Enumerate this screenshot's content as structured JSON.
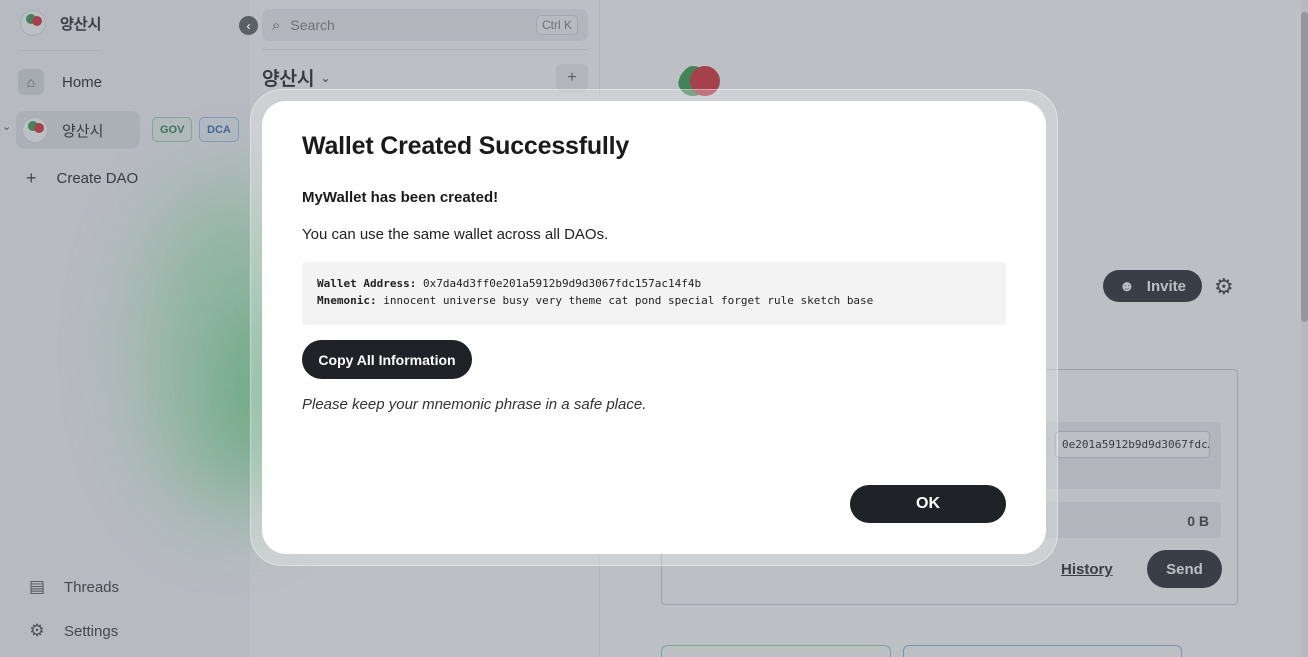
{
  "sidebar": {
    "brand_name": "양산시",
    "items": [
      {
        "label": "Home",
        "icon": "home-icon"
      },
      {
        "label": "양산시",
        "icon": "dao-logo-icon",
        "tags": [
          "GOV",
          "DCA"
        ]
      },
      {
        "label": "Create DAO",
        "icon": "plus-icon"
      }
    ],
    "bottom": [
      {
        "label": "Threads",
        "icon": "chat-icon"
      },
      {
        "label": "Settings",
        "icon": "gear-icon"
      }
    ]
  },
  "channel_panel": {
    "search_placeholder": "Search",
    "search_shortcut": "Ctrl K",
    "title": "양산시"
  },
  "main": {
    "invite_label": "Invite",
    "wallet_address_preview": "0e201a5912b9d9d3067fdc…",
    "balance": "0 B",
    "history_label": "History",
    "send_label": "Send"
  },
  "dialog": {
    "title": "Wallet Created Successfully",
    "subtitle": "MyWallet has been created!",
    "description": "You can use the same wallet across all DAOs.",
    "address_label": "Wallet Address:",
    "address_value": "0x7da4d3ff0e201a5912b9d9d3067fdc157ac14f4b",
    "mnemonic_label": "Mnemonic:",
    "mnemonic_value": "innocent universe busy very theme cat pond special forget rule sketch base",
    "copy_button": "Copy All Information",
    "note": "Please keep your mnemonic phrase in a safe place.",
    "ok_button": "OK"
  },
  "colors": {
    "button_dark": "#1f2227",
    "gov_tag": "#2a7d4e",
    "dca_tag": "#2c62b5",
    "overlay": "#5f6773"
  }
}
